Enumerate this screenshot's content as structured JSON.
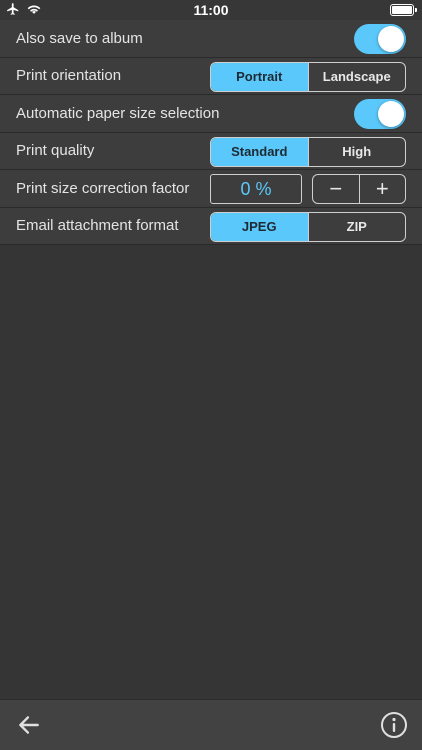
{
  "status_bar": {
    "time": "11:00",
    "left_icons": [
      "airplane-icon",
      "wifi-icon"
    ],
    "battery": "full"
  },
  "settings": {
    "also_save_to_album": {
      "label": "Also save to album",
      "on": true
    },
    "print_orientation": {
      "label": "Print orientation",
      "options": [
        "Portrait",
        "Landscape"
      ],
      "selected": "Portrait"
    },
    "automatic_paper_size": {
      "label": "Automatic paper size selection",
      "on": true
    },
    "print_quality": {
      "label": "Print quality",
      "options": [
        "Standard",
        "High"
      ],
      "selected": "Standard"
    },
    "print_size_correction": {
      "label": "Print size correction factor",
      "value": "0 %",
      "decrement": "−",
      "increment": "+"
    },
    "email_attachment_format": {
      "label": "Email attachment format",
      "options": [
        "JPEG",
        "ZIP"
      ],
      "selected": "JPEG"
    }
  },
  "toolbar": {
    "back_icon": "back-arrow-icon",
    "info_icon": "info-icon"
  },
  "colors": {
    "accent": "#5ac8fa",
    "background": "#353535",
    "row": "#3d3d3d"
  }
}
